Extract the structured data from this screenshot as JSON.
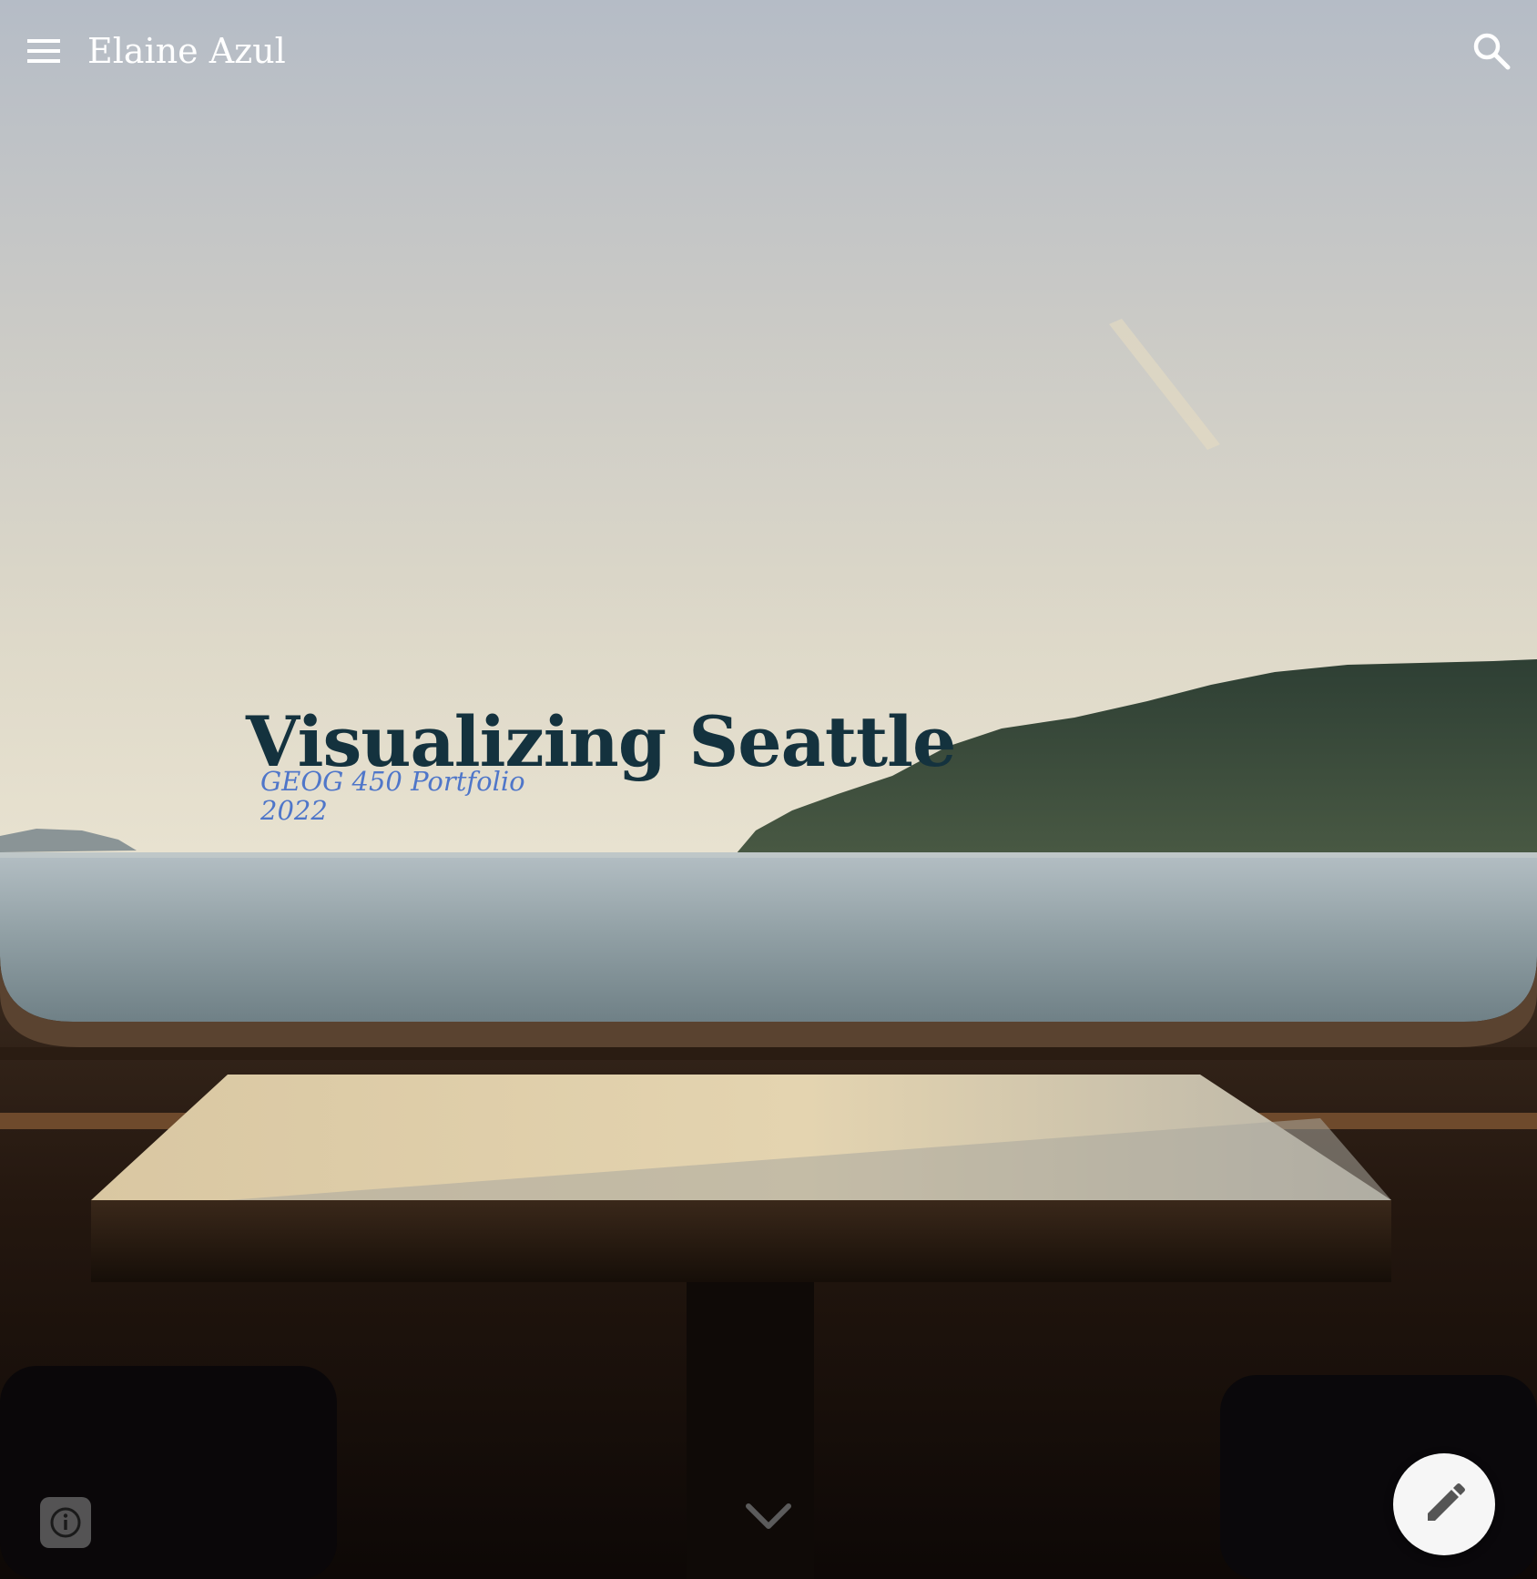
{
  "header": {
    "site_title": "Elaine Azul",
    "menu_icon": "hamburger-menu-icon",
    "search_icon": "search-icon"
  },
  "hero": {
    "title": "Visualizing Seattle",
    "subtitle_lines": [
      "GEOG 450 Portfolio",
      "2022"
    ],
    "background_description_icon": "ferry-window-sea-view-photo"
  },
  "controls": {
    "scroll_icon": "chevron-down-icon",
    "info_icon": "info-icon",
    "edit_icon": "pencil-icon"
  },
  "colors": {
    "title": "#14323e",
    "subtitle": "#4f76c9",
    "header_text": "#ffffff"
  }
}
